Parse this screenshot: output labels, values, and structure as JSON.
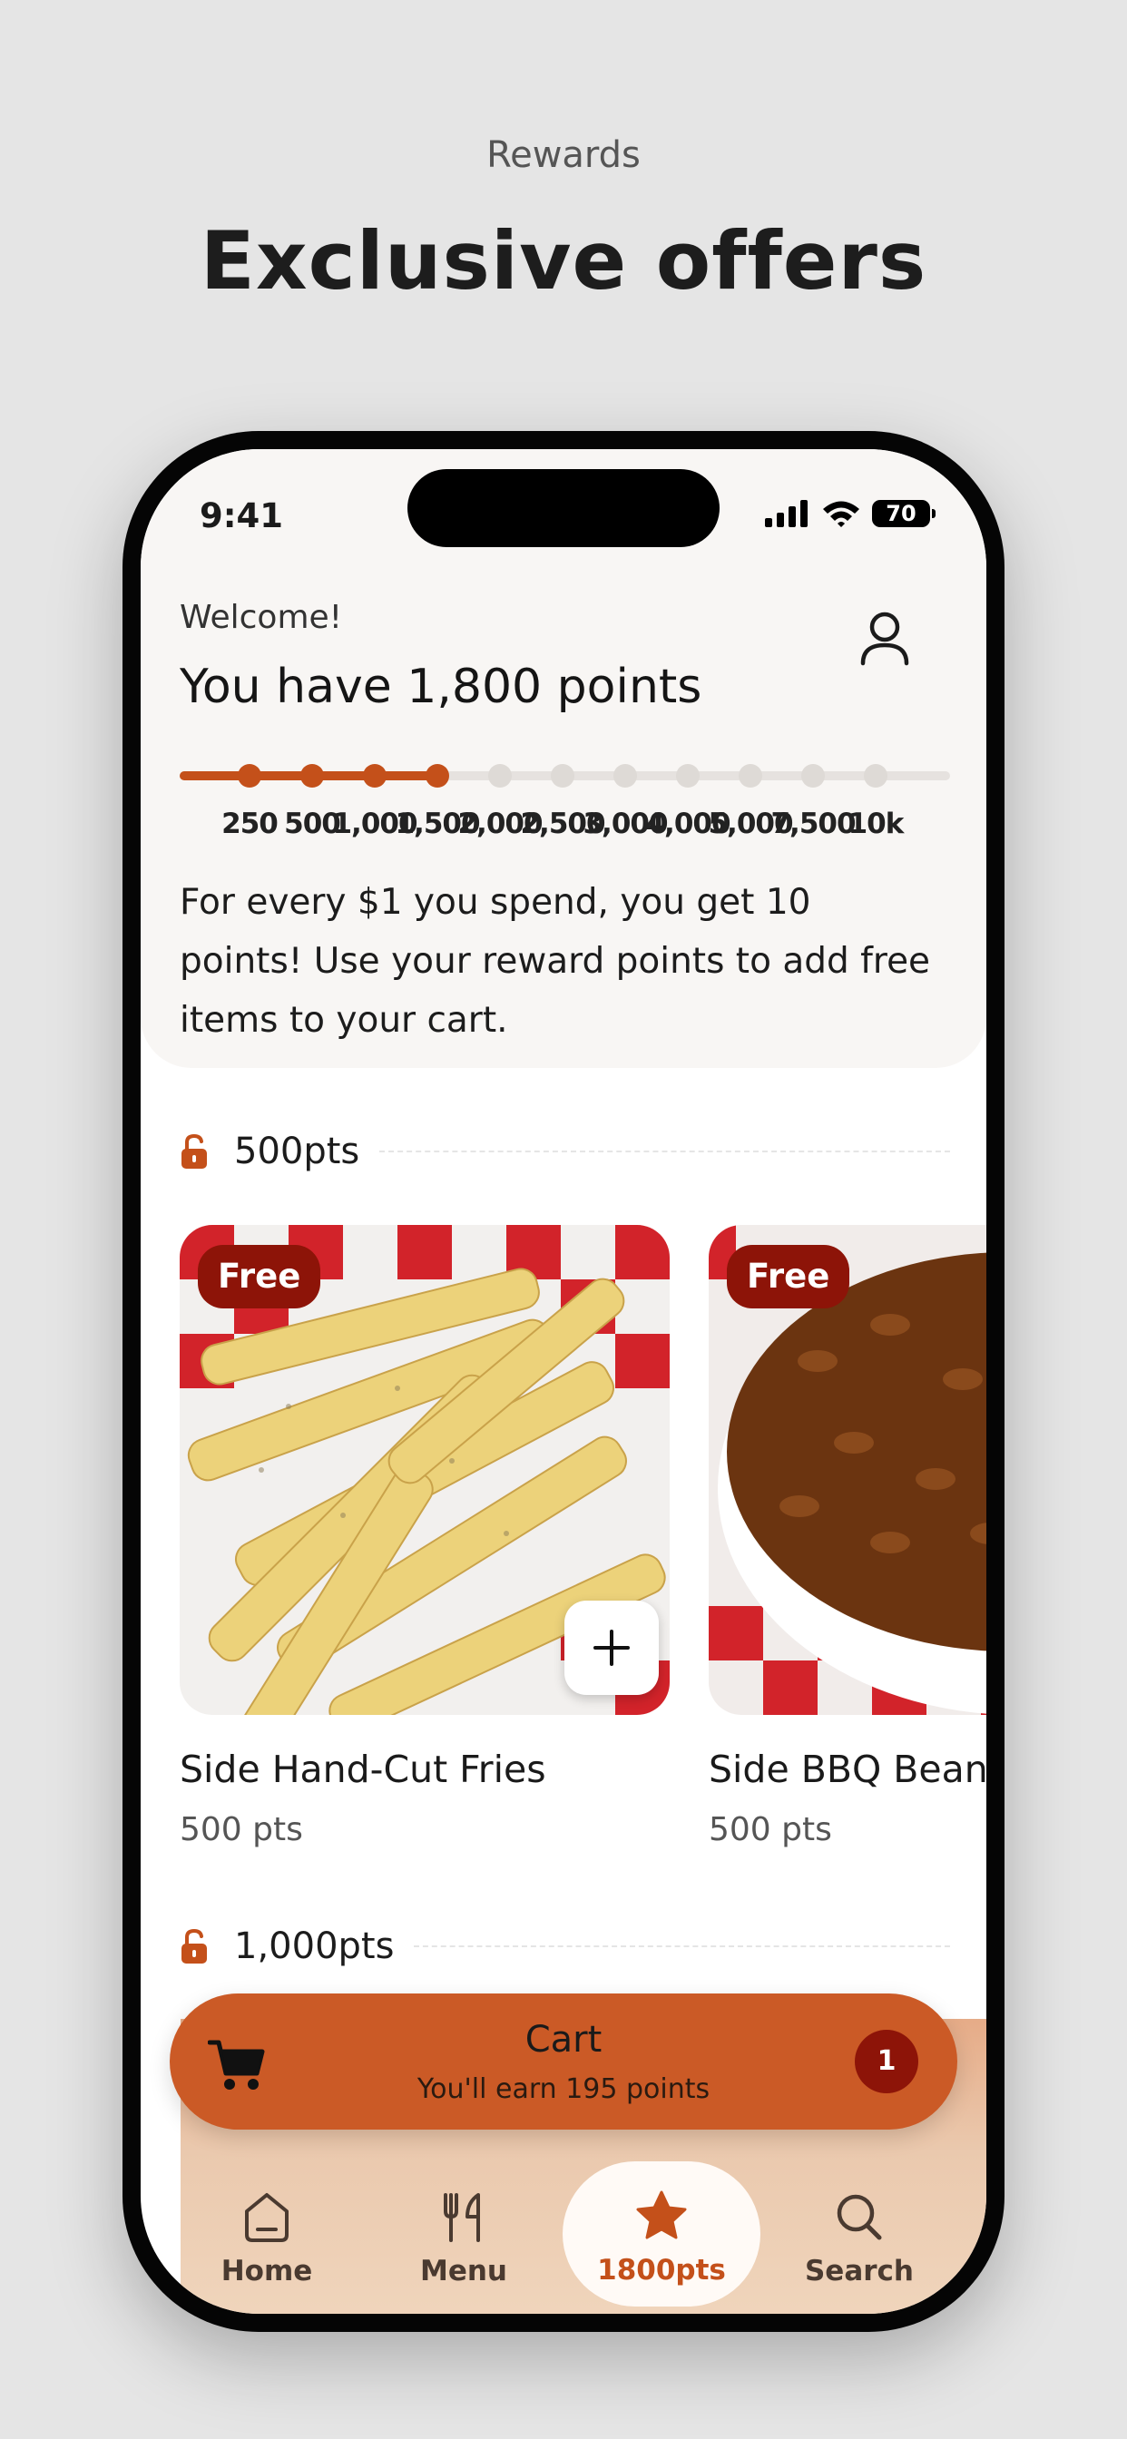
{
  "page": {
    "subtitle": "Rewards",
    "title": "Exclusive offers"
  },
  "status_bar": {
    "time": "9:41",
    "battery": "70"
  },
  "header": {
    "welcome": "Welcome!",
    "points_heading": "You have 1,800 points",
    "profile_icon": "person-icon",
    "info_text": "For every $1 you spend, you get 10 points! Use your reward points to add free items to your cart."
  },
  "progress": {
    "current_points": 1800,
    "tiers": [
      {
        "label": "250",
        "points": 250
      },
      {
        "label": "500",
        "points": 500
      },
      {
        "label": "1,000",
        "points": 1000
      },
      {
        "label": "1,500",
        "points": 1500
      },
      {
        "label": "2,000",
        "points": 2000
      },
      {
        "label": "2,500",
        "points": 2500
      },
      {
        "label": "3,000",
        "points": 3000
      },
      {
        "label": "4,000",
        "points": 4000
      },
      {
        "label": "5,000",
        "points": 5000
      },
      {
        "label": "7,500",
        "points": 7500
      },
      {
        "label": "10k",
        "points": 10000
      }
    ],
    "accent": "#c4501a",
    "track": "#e6e2df"
  },
  "sections": [
    {
      "label": "500pts",
      "icon": "unlocked-icon",
      "items": [
        {
          "badge": "Free",
          "name": "Side Hand-Cut Fries",
          "price": "500 pts"
        },
        {
          "badge": "Free",
          "name": "Side BBQ Beans",
          "price": "500 pts"
        }
      ]
    },
    {
      "label": "1,000pts",
      "icon": "unlocked-icon"
    }
  ],
  "cart": {
    "title": "Cart",
    "subtitle": "You'll earn 195 points",
    "count": "1",
    "icon": "cart-icon"
  },
  "tabs": [
    {
      "label": "Home",
      "icon": "home-icon"
    },
    {
      "label": "Menu",
      "icon": "fork-knife-icon"
    },
    {
      "label": "1800pts",
      "icon": "star-icon"
    },
    {
      "label": "Search",
      "icon": "search-icon"
    }
  ],
  "colors": {
    "accent": "#c4501a",
    "cart": "#cb5a26",
    "badge": "#8d1408",
    "background": "#e5e5e5"
  }
}
